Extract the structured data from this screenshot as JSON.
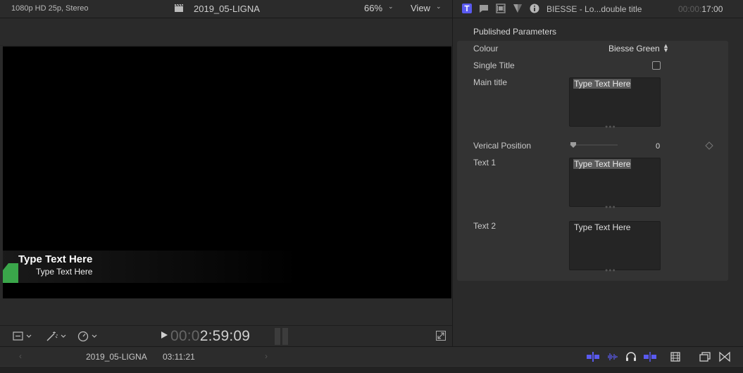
{
  "viewer": {
    "format_info": "1080p HD 25p, Stereo",
    "project_title": "2019_05-LIGNA",
    "zoom_level": "66%",
    "view_menu": "View",
    "canvas_main_text": "Type Text Here",
    "canvas_sub_text": "Type Text Here",
    "timecode_dim": "00:0",
    "timecode_bright": "2:59:09"
  },
  "inspector": {
    "clip_name": "BIESSE - Lo...double title",
    "duration_dim": "00:00:",
    "duration_bright": "17:00",
    "section_header": "Published Parameters",
    "colour_label": "Colour",
    "colour_value": "Biesse Green",
    "single_title_label": "Single Title",
    "single_title_checked": false,
    "main_title_label": "Main title",
    "main_title_value": "Type Text Here",
    "vertical_position_label": "Verical Position",
    "vertical_position_value": "0",
    "text1_label": "Text 1",
    "text1_value": "Type Text Here",
    "text2_label": "Text 2",
    "text2_value": "Type Text Here"
  },
  "timeline": {
    "project_name": "2019_05-LIGNA",
    "duration": "03:11:21"
  },
  "colors": {
    "accent_blue": "#5a5af0",
    "slash_green": "#3aa64a"
  }
}
